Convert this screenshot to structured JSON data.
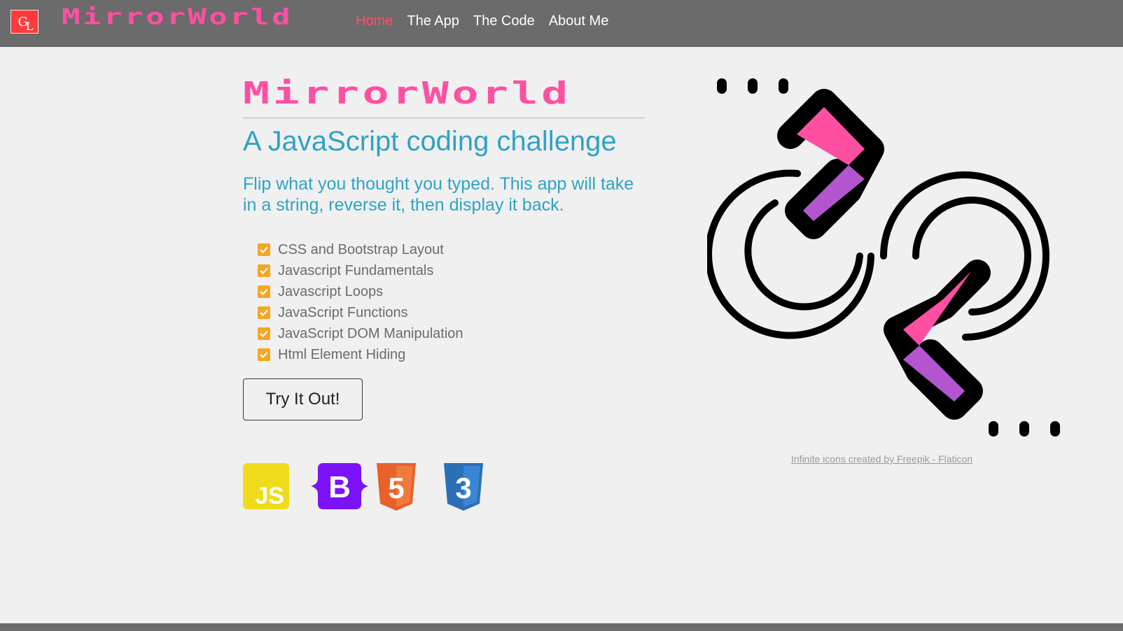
{
  "navbar": {
    "logo_letters": [
      "G",
      "L"
    ],
    "brand": "MirrorWorld",
    "links": [
      {
        "label": "Home",
        "active": true
      },
      {
        "label": "The App",
        "active": false
      },
      {
        "label": "The Code",
        "active": false
      },
      {
        "label": "About Me",
        "active": false
      }
    ]
  },
  "hero": {
    "title": "MirrorWorld",
    "subtitle": "A JavaScript coding challenge",
    "lead": "Flip what you thought you typed. This app will take in a string, reverse it, then display it back.",
    "features": [
      "CSS and Bootstrap Layout",
      "Javascript Fundamentals",
      "Javascript Loops",
      "JavaScript Functions",
      "JavaScript DOM Manipulation",
      "Html Element Hiding"
    ],
    "button_label": "Try It Out!",
    "tech_icons": [
      {
        "name": "javascript-icon",
        "text": "JS",
        "color": "#f0db1a"
      },
      {
        "name": "bootstrap-icon",
        "text": "B",
        "color": "#7b12f7"
      },
      {
        "name": "html5-icon",
        "text": "5",
        "color": "#e8612b"
      },
      {
        "name": "css3-icon",
        "text": "3",
        "color": "#2b6fb6"
      }
    ]
  },
  "illustration": {
    "icon": "infinite-arrows-icon",
    "credit": "Infinite icons created by Freepik - Flaticon"
  },
  "colors": {
    "navbar_bg": "#6b6b6b",
    "brand_pink": "#ff4fa3",
    "active_link": "#ff4f63",
    "heading_blue": "#2ea3c5",
    "check_orange": "#f5a623",
    "arrow_purple": "#b455d0"
  }
}
